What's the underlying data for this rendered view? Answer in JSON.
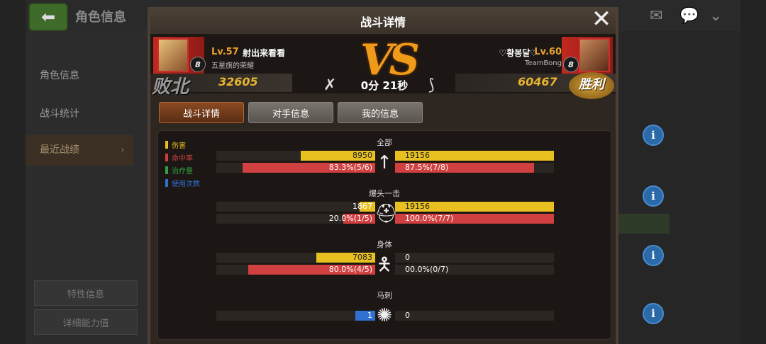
{
  "background": {
    "title": "角色信息",
    "menu": [
      "角色信息",
      "战斗统计",
      "最近战绩"
    ],
    "buttons": [
      "特性信息",
      "详细能力值"
    ],
    "info_label": "i"
  },
  "dialog": {
    "title": "战斗详情",
    "left_player": {
      "level": "Lv.57",
      "name": "射出来看看",
      "guild": "五星旗的荣耀",
      "rank_badge": "8",
      "score": "32605",
      "result": "败北"
    },
    "right_player": {
      "level": "Lv.60",
      "name": "♡황봉달♡",
      "guild": "TeamBong",
      "rank_badge": "8",
      "score": "60467",
      "result": "胜利"
    },
    "vs_label": "VS",
    "timer": "0分 21秒",
    "tabs": [
      "战斗详情",
      "对手信息",
      "我的信息"
    ],
    "legend": [
      {
        "label": "伤害",
        "color": "#e8c020"
      },
      {
        "label": "命中率",
        "color": "#d04040"
      },
      {
        "label": "治疗量",
        "color": "#30a040"
      },
      {
        "label": "使用次数",
        "color": "#3070d0"
      }
    ]
  },
  "chart_data": {
    "type": "bar",
    "categories": [
      {
        "name": "全部",
        "icon": "arrow-icon",
        "rows": [
          {
            "metric": "伤害",
            "left": {
              "value": 8950,
              "label": "8950"
            },
            "right": {
              "value": 19156,
              "label": "19156"
            }
          },
          {
            "metric": "命中率",
            "left": {
              "value": 83.3,
              "label": "83.3%(5/6)"
            },
            "right": {
              "value": 87.5,
              "label": "87.5%(7/8)"
            }
          }
        ]
      },
      {
        "name": "爆头一击",
        "icon": "helmet-icon",
        "rows": [
          {
            "metric": "伤害",
            "left": {
              "value": 1867,
              "label": "1867"
            },
            "right": {
              "value": 19156,
              "label": "19156"
            }
          },
          {
            "metric": "命中率",
            "left": {
              "value": 20.0,
              "label": "20.0%(1/5)"
            },
            "right": {
              "value": 100.0,
              "label": "100.0%(7/7)"
            }
          }
        ]
      },
      {
        "name": "身体",
        "icon": "body-icon",
        "rows": [
          {
            "metric": "伤害",
            "left": {
              "value": 7083,
              "label": "7083"
            },
            "right": {
              "value": 0,
              "label": "0"
            }
          },
          {
            "metric": "命中率",
            "left": {
              "value": 80.0,
              "label": "80.0%(4/5)"
            },
            "right": {
              "value": 0,
              "label": "00.0%(0/7)"
            }
          }
        ]
      },
      {
        "name": "马刺",
        "icon": "spur-icon",
        "rows": [
          {
            "metric": "使用次数",
            "left": {
              "value": 1,
              "label": "1"
            },
            "right": {
              "value": 0,
              "label": "0"
            }
          }
        ]
      }
    ]
  }
}
